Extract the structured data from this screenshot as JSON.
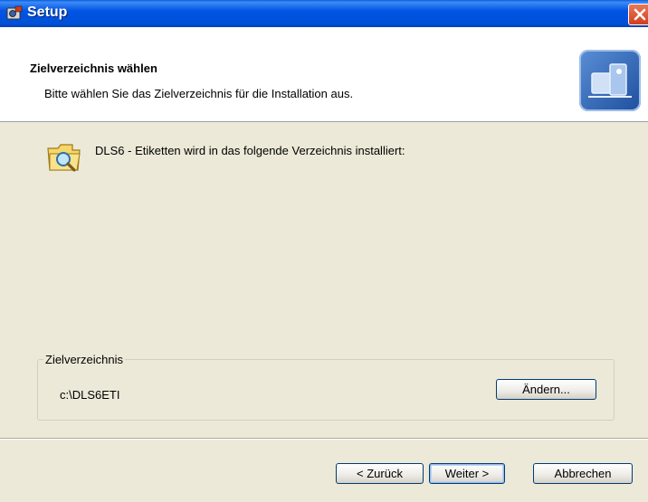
{
  "window": {
    "title": "Setup"
  },
  "header": {
    "title": "Zielverzeichnis wählen",
    "subtitle": "Bitte wählen Sie das Zielverzeichnis für die Installation aus."
  },
  "body": {
    "message": "DLS6 - Etiketten wird in das folgende Verzeichnis installiert:"
  },
  "destination": {
    "group_label": "Zielverzeichnis",
    "path": "c:\\DLS6ETI",
    "change_label": "Ändern..."
  },
  "buttons": {
    "back": "< Zurück",
    "next": "Weiter >",
    "cancel": "Abbrechen"
  },
  "colors": {
    "titlebar": "#0054e3",
    "dialog_bg": "#ece9d8",
    "close_button": "#d1401c"
  },
  "icons": [
    "setup-app-icon",
    "close-icon",
    "installer-logo-icon",
    "folder-search-icon"
  ]
}
